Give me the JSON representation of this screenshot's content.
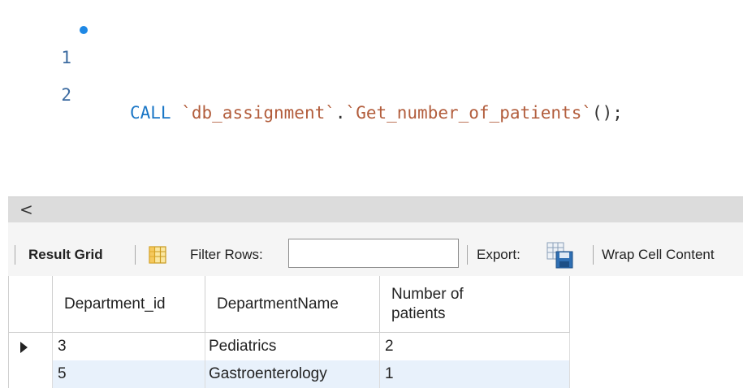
{
  "editor": {
    "lines": [
      {
        "number": "1",
        "has_dot": true,
        "tokens": {
          "keyword": "CALL",
          "schema": "`db_assignment`",
          "dot": ".",
          "proc": "`Get_number_of_patients`",
          "end": "();"
        }
      },
      {
        "number": "2",
        "has_dot": false
      }
    ],
    "colors": {
      "keyword": "#1a76c6",
      "string": "#b25d3c",
      "line_number": "#3b6aa0",
      "dot": "#1e88e5"
    }
  },
  "scrollbar": {
    "left_arrow": "<"
  },
  "toolbar": {
    "result_grid_label": "Result Grid",
    "grid_icon": "result-grid-icon",
    "filter_label": "Filter Rows:",
    "filter_value": "",
    "export_label": "Export:",
    "export_icon": "export-save-icon",
    "wrap_label": "Wrap Cell Content"
  },
  "result_grid": {
    "columns": [
      "Department_id",
      "DepartmentName",
      "Number of patients"
    ],
    "rows": [
      {
        "Department_id": "3",
        "DepartmentName": "Pediatrics",
        "Number_of_patients": "2",
        "current": true
      },
      {
        "Department_id": "5",
        "DepartmentName": "Gastroenterology",
        "Number_of_patients": "1",
        "current": false
      }
    ],
    "row_highlight": "#e8f1fb"
  }
}
